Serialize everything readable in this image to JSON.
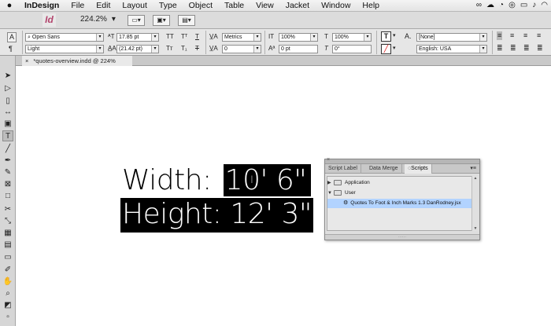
{
  "menubar": {
    "apple": "",
    "app_name": "InDesign",
    "items": [
      "File",
      "Edit",
      "Layout",
      "Type",
      "Object",
      "Table",
      "View",
      "Jacket",
      "Window",
      "Help"
    ],
    "status_icons": [
      "glasses-icon",
      "cloud-icon",
      "time-machine-icon",
      "creative-cloud-icon",
      "battery-icon",
      "volume-icon",
      "wifi-icon"
    ]
  },
  "appbar": {
    "logo": "Id",
    "zoom": "224.2%"
  },
  "control": {
    "font_family": "Open Sans",
    "font_style": "Light",
    "font_size": "17.85 pt",
    "leading": "(21.42 pt)",
    "kerning": "Metrics",
    "tracking": "0",
    "vertical_scale": "100%",
    "horizontal_scale": "100%",
    "baseline_shift": "0 pt",
    "skew": "0°",
    "char_style": "[None]",
    "language": "English: USA",
    "lang_label": "A."
  },
  "document": {
    "tab_title": "*quotes-overview.indd @ 224%"
  },
  "canvas": {
    "line1_label": "Width: ",
    "line1_value": "10' 6\"",
    "line2": "Height: 12' 3\""
  },
  "scripts_panel": {
    "tabs": [
      "Script Label",
      "Data Merge",
      "Scripts"
    ],
    "items": [
      {
        "label": "Application",
        "type": "folder"
      },
      {
        "label": "User",
        "type": "folder"
      },
      {
        "label": "Quotes To Foot & Inch Marks 1.3 DanRodney.jsx",
        "type": "script"
      }
    ]
  }
}
